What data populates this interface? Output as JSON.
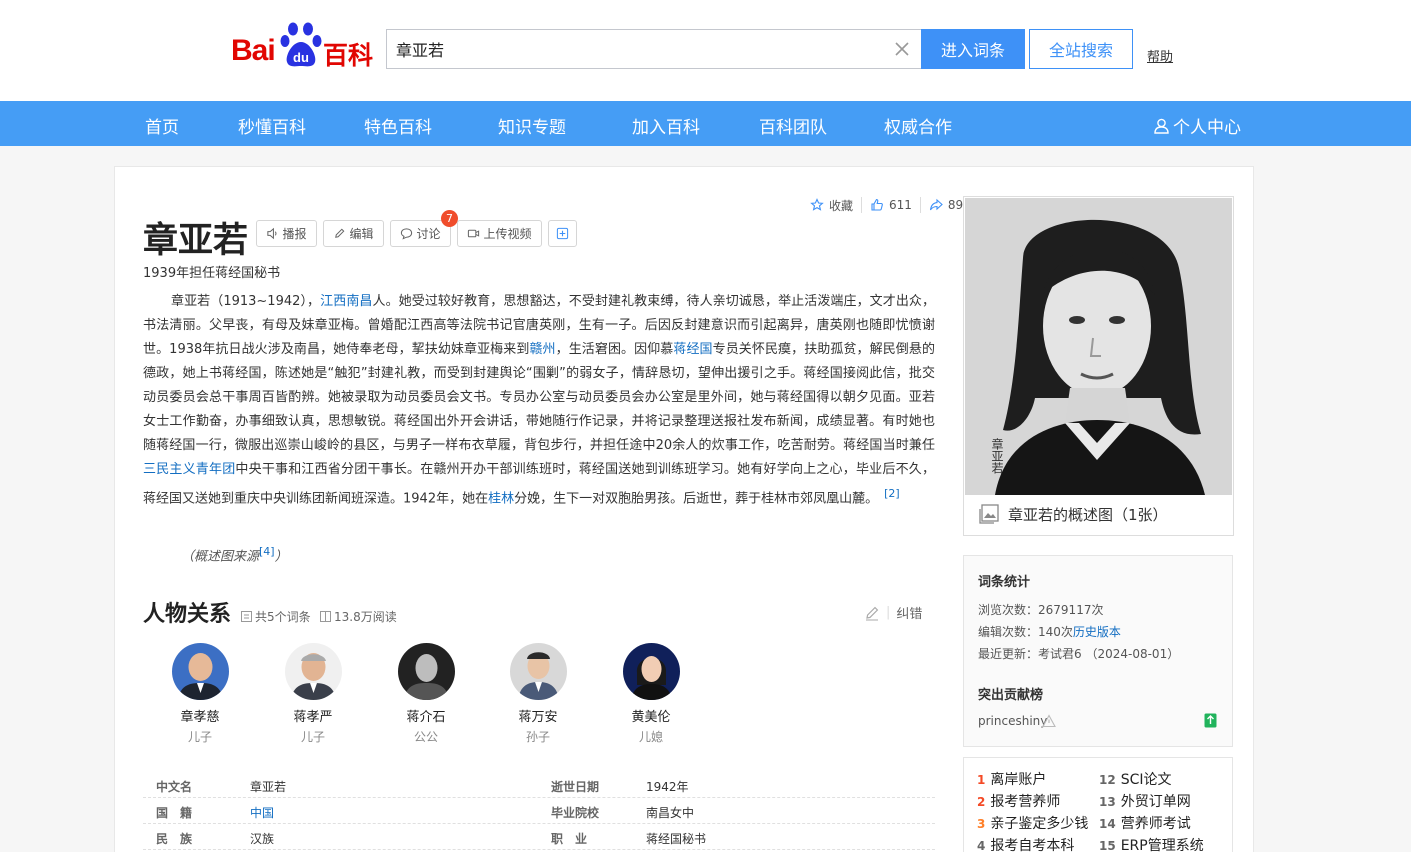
{
  "colors": {
    "brand_red": "#e10602",
    "nav_blue": "#459df5",
    "button_blue": "#3e91f7",
    "link": "#136ec2",
    "badge": "#f04d2c"
  },
  "header": {
    "logo": {
      "bai": "Bai",
      "du": "du",
      "baike": "百科"
    },
    "search": {
      "value": "章亚若"
    },
    "enter_label": "进入词条",
    "site_search_label": "全站搜索",
    "help_label": "帮助"
  },
  "nav": {
    "items": [
      "首页",
      "秒懂百科",
      "特色百科",
      "知识专题",
      "加入百科",
      "百科团队",
      "权威合作"
    ],
    "user": "个人中心"
  },
  "entry": {
    "title": "章亚若",
    "buttons": {
      "broadcast": "播报",
      "edit": "编辑",
      "discuss": "讨论",
      "upload": "上传视频"
    },
    "discuss_badge": "7",
    "subtitle": "1939年担任蒋经国秘书",
    "actions": {
      "collect": "收藏",
      "likes": "611",
      "shares": "89"
    },
    "summary": [
      {
        "t": "章亚若（1913~1942），"
      },
      {
        "t": "江西南昌",
        "link": true
      },
      {
        "t": "人。她受过较好教育，思想豁达，不受封建礼教束缚，待人亲切诚恳，举止活泼端庄，文才出众，书法清丽。父早丧，有母及妹章亚梅。曾婚配江西高等法院书记官唐英刚，生有一子。后因反封建意识而引起离异，唐英刚也随即忧愤谢世。1938年抗日战火涉及南昌，她侍奉老母，挈扶幼妹章亚梅来到"
      },
      {
        "t": "赣州",
        "link": true
      },
      {
        "t": "，生活窘困。因仰慕"
      },
      {
        "t": "蒋经国",
        "link": true
      },
      {
        "t": "专员关怀民瘼，扶助孤贫，解民倒悬的德政，她上书蒋经国，陈述她是“触犯”封建礼教，而受到封建舆论“围剿”的弱女子，情辞恳切，望伸出援引之手。蒋经国接阅此信，批交动员委员会总干事周百皆酌辨。她被录取为动员委员会文书。专员办公室与动员委员会办公室是里外间，她与蒋经国得以朝夕见面。亚若女士工作勤奋，办事细致认真，思想敏锐。蒋经国出外开会讲话，带她随行作记录，并将记录整理送报社发布新闻，成绩显著。有时她也随蒋经国一行，微服出巡崇山峻岭的县区，与男子一样布衣草履，背包步行，并担任途中20余人的炊事工作，吃苦耐劳。蒋经国当时兼任"
      },
      {
        "t": "三民主义青年团",
        "link": true
      },
      {
        "t": "中央干事和江西省分团干事长。在赣州开办干部训练班时，蒋经国送她到训练班学习。她有好学向上之心，毕业后不久，蒋经国又送她到重庆中央训练团新闻班深造。1942年，她在"
      },
      {
        "t": "桂林",
        "link": true
      },
      {
        "t": "分娩，生下一对双胞胎男孩。后逝世，葬于桂林市郊凤凰山麓。"
      }
    ],
    "summary_ref": "[2]",
    "source_text": "（概述图来源",
    "source_ref": "[4]",
    "source_end": "）"
  },
  "relations": {
    "title": "人物关系",
    "count": "共5个词条",
    "reads": "13.8万阅读",
    "correct": "纠错",
    "people": [
      {
        "name": "章孝慈",
        "rel": "儿子"
      },
      {
        "name": "蒋孝严",
        "rel": "儿子"
      },
      {
        "name": "蒋介石",
        "rel": "公公"
      },
      {
        "name": "蒋万安",
        "rel": "孙子"
      },
      {
        "name": "黄美伦",
        "rel": "儿媳"
      }
    ]
  },
  "info": [
    {
      "lk": "中文名",
      "lv": "章亚若",
      "rk": "逝世日期",
      "rv": "1942年"
    },
    {
      "lk": "国　籍",
      "lv": "中国",
      "rk": "毕业院校",
      "rv": "南昌女中"
    },
    {
      "lk": "民　族",
      "lv": "汉族",
      "rk": "职　业",
      "rv": "蒋经国秘书"
    }
  ],
  "sidebar": {
    "photo_inscription": "章亚若",
    "pic_caption": "章亚若的概述图（1张）",
    "stats": {
      "title": "词条统计",
      "views_label": "浏览次数：",
      "views": "2679117次",
      "edits_label": "编辑次数：",
      "edits": "140次",
      "history": "历史版本",
      "updated_label": "最近更新：",
      "updated": "考试君6 （2024-08-01）"
    },
    "contrib": {
      "title": "突出贡献榜",
      "user": "princeshiny"
    },
    "hot": [
      {
        "n": "1",
        "t": "离岸账户"
      },
      {
        "n": "12",
        "t": "SCI论文"
      },
      {
        "n": "2",
        "t": "报考营养师"
      },
      {
        "n": "13",
        "t": "外贸订单网"
      },
      {
        "n": "3",
        "t": "亲子鉴定多少钱"
      },
      {
        "n": "14",
        "t": "营养师考试"
      },
      {
        "n": "4",
        "t": "报考自考本科"
      },
      {
        "n": "15",
        "t": "ERP管理系统"
      }
    ]
  }
}
